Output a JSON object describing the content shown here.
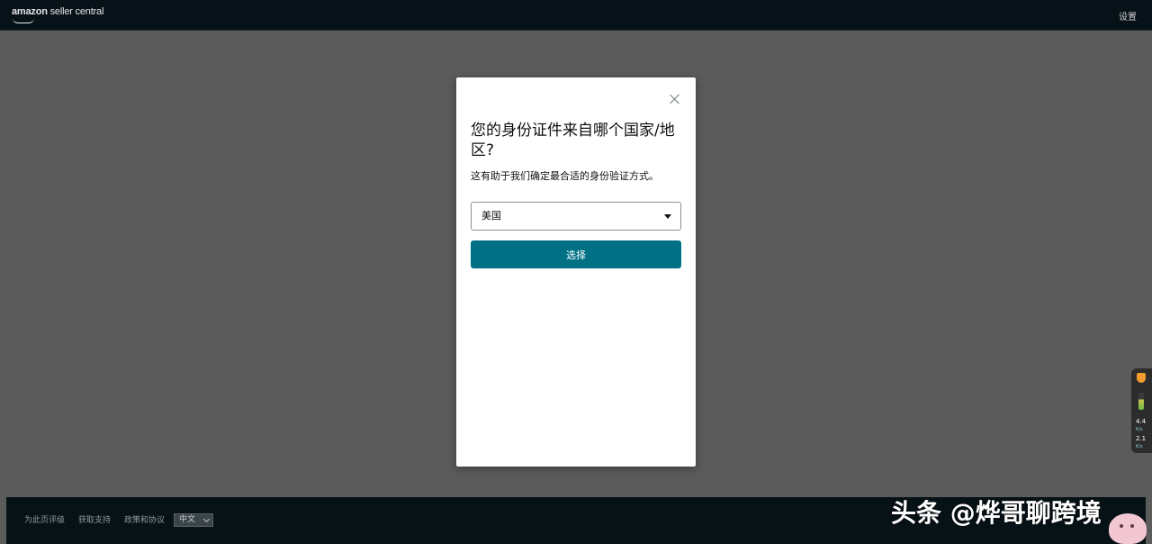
{
  "header": {
    "brand": "amazon",
    "product": "seller central",
    "settings_label": "设置"
  },
  "dialog": {
    "title": "您的身份证件来自哪个国家/地区?",
    "subtitle": "这有助于我们确定最合适的身份验证方式。",
    "select_value": "美国",
    "submit_label": "选择"
  },
  "footer": {
    "links": [
      "为此页评级",
      "获取支持",
      "政策和协议"
    ],
    "language": "中文"
  },
  "overlay": {
    "watermark": "头条 @烨哥聊跨境",
    "speed_up": "4.4",
    "speed_down": "2.1",
    "speed_unit": "K/s"
  },
  "colors": {
    "primary_button": "#007185",
    "header_bg": "#061218",
    "overlay_bg": "#5b5b5b"
  }
}
